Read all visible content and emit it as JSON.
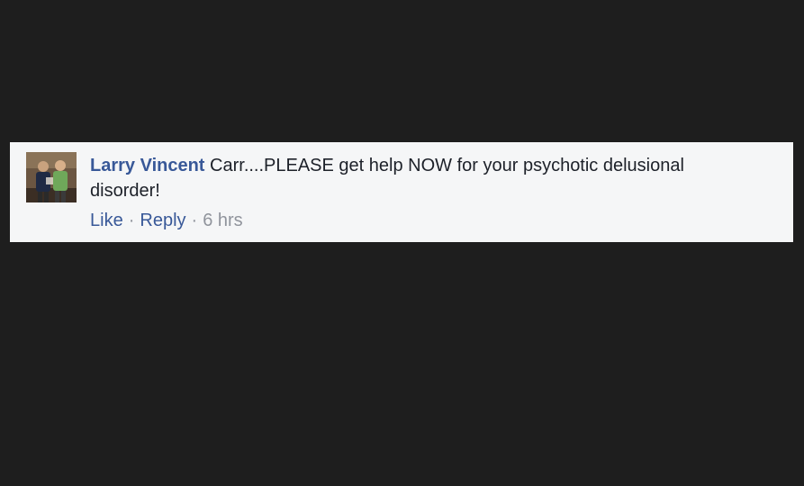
{
  "comment": {
    "author": "Larry Vincent",
    "text": "Carr....PLEASE get help NOW for your psychotic delusional disorder!",
    "actions": {
      "like_label": "Like",
      "reply_label": "Reply",
      "separator": "·",
      "timestamp": "6 hrs"
    }
  },
  "colors": {
    "page_background": "#1e1e1e",
    "card_background": "#f5f6f7",
    "link": "#385898",
    "text": "#1d2129",
    "meta": "#90949c"
  },
  "icons": {
    "avatar": "profile-photo"
  }
}
